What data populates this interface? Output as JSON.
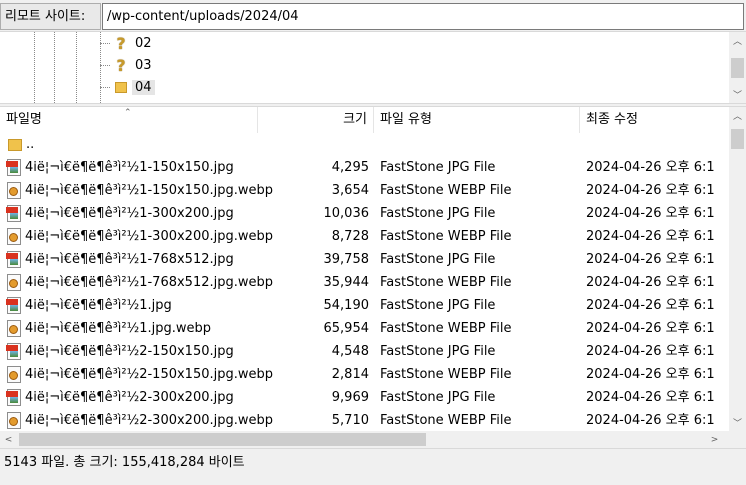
{
  "pathbar": {
    "label": "리모트 사이트:",
    "path": "/wp-content/uploads/2024/04"
  },
  "tree": {
    "items": [
      {
        "label": "02",
        "icon": "question-icon",
        "selected": false
      },
      {
        "label": "03",
        "icon": "question-icon",
        "selected": false
      },
      {
        "label": "04",
        "icon": "folder-icon",
        "selected": true
      }
    ]
  },
  "list": {
    "columns": {
      "name": "파일명",
      "size": "크기",
      "type": "파일 유형",
      "modified": "최종 수정"
    },
    "parent_dir": "..",
    "rows": [
      {
        "name": "4ië¦¬ì€ë¶ë¶ê³ì²½1-150x150.jpg",
        "size": "4,295",
        "type": "FastStone JPG File",
        "modified": "2024-04-26 오후 6:1",
        "kind": "jpg"
      },
      {
        "name": "4ië¦¬ì€ë¶ë¶ê³ì²½1-150x150.jpg.webp",
        "size": "3,654",
        "type": "FastStone WEBP File",
        "modified": "2024-04-26 오후 6:1",
        "kind": "webp"
      },
      {
        "name": "4ië¦¬ì€ë¶ë¶ê³ì²½1-300x200.jpg",
        "size": "10,036",
        "type": "FastStone JPG File",
        "modified": "2024-04-26 오후 6:1",
        "kind": "jpg"
      },
      {
        "name": "4ië¦¬ì€ë¶ë¶ê³ì²½1-300x200.jpg.webp",
        "size": "8,728",
        "type": "FastStone WEBP File",
        "modified": "2024-04-26 오후 6:1",
        "kind": "webp"
      },
      {
        "name": "4ië¦¬ì€ë¶ë¶ê³ì²½1-768x512.jpg",
        "size": "39,758",
        "type": "FastStone JPG File",
        "modified": "2024-04-26 오후 6:1",
        "kind": "jpg"
      },
      {
        "name": "4ië¦¬ì€ë¶ë¶ê³ì²½1-768x512.jpg.webp",
        "size": "35,944",
        "type": "FastStone WEBP File",
        "modified": "2024-04-26 오후 6:1",
        "kind": "webp"
      },
      {
        "name": "4ië¦¬ì€ë¶ë¶ê³ì²½1.jpg",
        "size": "54,190",
        "type": "FastStone JPG File",
        "modified": "2024-04-26 오후 6:1",
        "kind": "jpg"
      },
      {
        "name": "4ië¦¬ì€ë¶ë¶ê³ì²½1.jpg.webp",
        "size": "65,954",
        "type": "FastStone WEBP File",
        "modified": "2024-04-26 오후 6:1",
        "kind": "webp"
      },
      {
        "name": "4ië¦¬ì€ë¶ë¶ê³ì²½2-150x150.jpg",
        "size": "4,548",
        "type": "FastStone JPG File",
        "modified": "2024-04-26 오후 6:1",
        "kind": "jpg"
      },
      {
        "name": "4ië¦¬ì€ë¶ë¶ê³ì²½2-150x150.jpg.webp",
        "size": "2,814",
        "type": "FastStone WEBP File",
        "modified": "2024-04-26 오후 6:1",
        "kind": "webp"
      },
      {
        "name": "4ië¦¬ì€ë¶ë¶ê³ì²½2-300x200.jpg",
        "size": "9,969",
        "type": "FastStone JPG File",
        "modified": "2024-04-26 오후 6:1",
        "kind": "jpg"
      },
      {
        "name": "4ië¦¬ì€ë¶ë¶ê³ì²½2-300x200.jpg.webp",
        "size": "5,710",
        "type": "FastStone WEBP File",
        "modified": "2024-04-26 오후 6:1",
        "kind": "webp"
      }
    ]
  },
  "status": {
    "text": "5143 파일. 총 크기: 155,418,284 바이트"
  }
}
